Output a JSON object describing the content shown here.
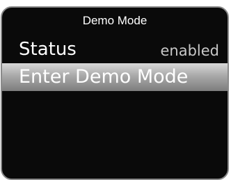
{
  "header": {
    "title": "Demo Mode"
  },
  "menu": {
    "status_label": "Status",
    "status_value": "enabled",
    "enter_label": "Enter Demo Mode"
  },
  "colors": {
    "background": "#0a0a0a",
    "text": "#ffffff",
    "value_text": "#c8c8c8",
    "selection_highlight_top": "#d8d8d8",
    "selection_highlight_bottom": "#7d7d7d"
  }
}
